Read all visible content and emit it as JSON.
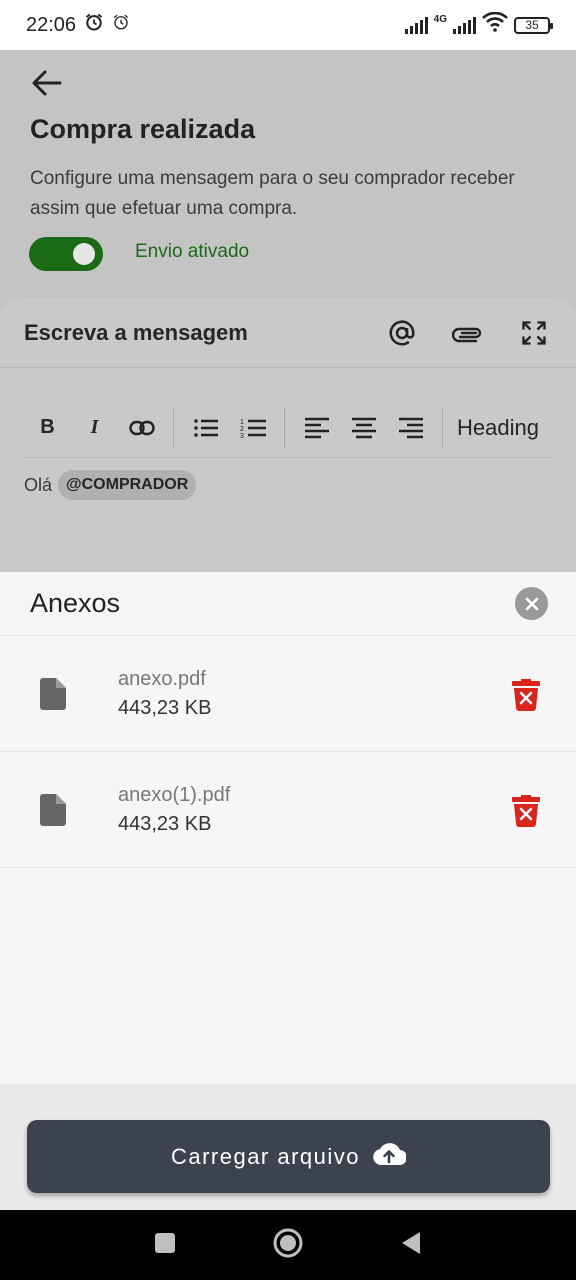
{
  "status_bar": {
    "time": "22:06",
    "network": "4G",
    "battery": "35",
    "icons": [
      "alarm-icon",
      "alarm-outline-icon",
      "signal-icon",
      "signal-4g-icon",
      "wifi-icon",
      "battery-icon"
    ]
  },
  "page": {
    "title": "Compra realizada",
    "description": "Configure uma mensagem para o seu comprador receber assim que efetuar uma compra.",
    "toggle": {
      "label": "Envio ativado",
      "on": true,
      "color": "#1b6b16"
    }
  },
  "editor": {
    "title": "Escreva a mensagem",
    "header_icons": [
      "mention-icon",
      "paperclip-icon",
      "fullscreen-icon"
    ],
    "toolbar": {
      "bold": "B",
      "italic": "I",
      "heading": "Heading",
      "icons": [
        "link-icon",
        "bullet-list-icon",
        "numbered-list-icon",
        "align-left-icon",
        "align-center-icon",
        "align-right-icon"
      ]
    },
    "content": {
      "text": "Olá",
      "mention": "@COMPRADOR"
    }
  },
  "sheet": {
    "title": "Anexos",
    "files": [
      {
        "name": "anexo.pdf",
        "size": "443,23 KB"
      },
      {
        "name": "anexo(1).pdf",
        "size": "443,23 KB"
      }
    ],
    "upload_label": "Carregar arquivo",
    "delete_color": "#d9251c",
    "button_color": "#3d4250"
  },
  "nav": {
    "icons": [
      "recents-icon",
      "home-icon",
      "back-triangle-icon"
    ]
  }
}
